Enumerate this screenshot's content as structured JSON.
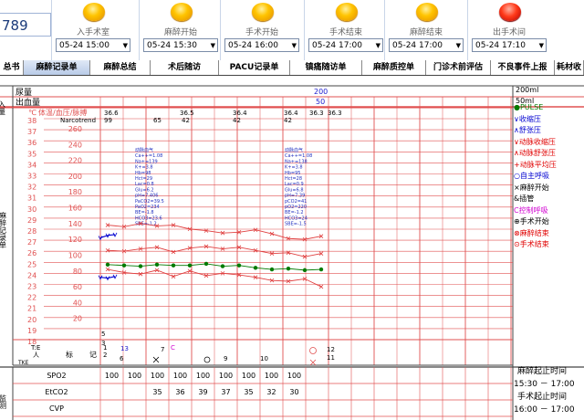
{
  "patient_id": "789",
  "stages": [
    {
      "label": "入手术室",
      "time": "05-24 15:00",
      "color": "yellow"
    },
    {
      "label": "麻醉开始",
      "time": "05-24 15:30",
      "color": "yellow"
    },
    {
      "label": "手术开始",
      "time": "05-24 16:00",
      "color": "yellow"
    },
    {
      "label": "手术结束",
      "time": "05-24 17:00",
      "color": "yellow"
    },
    {
      "label": "麻醉结束",
      "time": "05-24 17:00",
      "color": "yellow"
    },
    {
      "label": "出手术间",
      "time": "05-24 17:10",
      "color": "red"
    }
  ],
  "tabs": [
    {
      "label": "总书",
      "active": false
    },
    {
      "label": "麻醉记录单",
      "active": true
    },
    {
      "label": "麻醉总结",
      "active": false
    },
    {
      "label": "术后随访",
      "active": false
    },
    {
      "label": "PACU记录单",
      "active": false
    },
    {
      "label": "镇痛随访单",
      "active": false
    },
    {
      "label": "麻醉质控单",
      "active": false
    },
    {
      "label": "门诊术前评估",
      "active": false
    },
    {
      "label": "不良事件上报",
      "active": false
    },
    {
      "label": "耗材收",
      "active": false
    }
  ],
  "io_rows": {
    "side_label": "出入量",
    "urine_label": "尿量",
    "output_label": "出血量",
    "urine_value": "200",
    "output_value": "50",
    "urine_total": "200ml",
    "output_total": "50ml"
  },
  "temp_header": {
    "label": "体温/血压/脉搏",
    "temp_unit": "℃",
    "temps": [
      "36.6",
      "36.5",
      "36.4",
      "36.4",
      "36.3",
      "36.3"
    ],
    "narcotrend_label": "Narcotrend",
    "narcotrend_values": [
      "99",
      "65",
      "42",
      "42",
      "42"
    ]
  },
  "axes": {
    "temp_ticks": [
      "38",
      "37",
      "36",
      "35",
      "34",
      "33",
      "32",
      "31",
      "30",
      "29",
      "28",
      "27",
      "26",
      "25",
      "24",
      "23",
      "22",
      "21",
      "20",
      "19",
      "18"
    ],
    "bp_ticks": [
      "260",
      "240",
      "220",
      "200",
      "180",
      "160",
      "140",
      "120",
      "100",
      "80",
      "60",
      "40",
      "20"
    ],
    "side_label": "麻醉记录单"
  },
  "blood_gas": [
    {
      "lines": [
        "动脉血气",
        "Ca++=1.08",
        "Na+=139",
        "K+=3.8",
        "Hb=98",
        "Hct=29",
        "Lac=0.8",
        "Glu=6.2",
        "pH=7.406",
        "PaCO2=39.5",
        "PaO2=234",
        "BE=-1.8",
        "HCO3=23.6",
        "SBE=-1.2"
      ]
    },
    {
      "lines": [
        "动脉血气",
        "Ca++=1.08",
        "Na+=138",
        "K+=3.8",
        "Hb=95",
        "Hct=28",
        "Lac=0.9",
        "Glu=6.8",
        "pH=7.39",
        "pCO2=41",
        "pO2=220",
        "BE=-1.2",
        "HCO3=24",
        "SBE=-1.5"
      ]
    }
  ],
  "legend": [
    {
      "label": "●PULSE",
      "color": "#007a00"
    },
    {
      "label": "∨收缩压",
      "color": "#0000d0"
    },
    {
      "label": "∧舒张压",
      "color": "#0000d0"
    },
    {
      "label": "∨动脉收缩压",
      "color": "#e00000"
    },
    {
      "label": "∧动脉舒张压",
      "color": "#e00000"
    },
    {
      "label": "+动脉平均压",
      "color": "#e00000"
    },
    {
      "label": "○自主呼吸",
      "color": "#0000d0"
    },
    {
      "label": "×麻醉开始",
      "color": "#000000"
    },
    {
      "label": "&插管",
      "color": "#000000"
    },
    {
      "label": "C控制呼吸",
      "color": "#d000d0"
    },
    {
      "label": "⊕手术开始",
      "color": "#000000"
    },
    {
      "label": "⊗麻醉结束",
      "color": "#e00000"
    },
    {
      "label": "⊙手术结束",
      "color": "#e00000"
    }
  ],
  "chart_data": {
    "type": "line",
    "x_columns": 12,
    "series": [
      {
        "name": "动脉收缩压",
        "color": "#e04040",
        "values": [
          138,
          136,
          140,
          137,
          138,
          133,
          131,
          128,
          129,
          132,
          127,
          121,
          120,
          124
        ]
      },
      {
        "name": "动脉平均压",
        "color": "#e04040",
        "values": [
          106,
          105,
          108,
          110,
          104,
          109,
          111,
          108,
          110,
          106,
          102,
          103,
          98,
          102
        ]
      },
      {
        "name": "PULSE",
        "color": "#007a00",
        "values": [
          88,
          87,
          86,
          88,
          87,
          87,
          89,
          86,
          87,
          84,
          82,
          83,
          81,
          82
        ]
      },
      {
        "name": "动脉舒张压",
        "color": "#e04040",
        "values": [
          82,
          78,
          76,
          81,
          73,
          80,
          74,
          77,
          75,
          72,
          68,
          67,
          70,
          60
        ]
      },
      {
        "name": "收缩压",
        "color": "#0000d0",
        "values": [
          122,
          125,
          126
        ]
      },
      {
        "name": "舒张压",
        "color": "#0000d0",
        "values": [
          72,
          71,
          73
        ]
      }
    ],
    "bp_range": [
      0,
      260
    ],
    "temp_range": [
      18,
      38
    ]
  },
  "markers_row": {
    "labels": [
      "标",
      "记"
    ],
    "y_labels": [
      "T:E",
      "人"
    ],
    "items": [
      "1",
      "2",
      "13",
      "7",
      "C",
      "6",
      "9",
      "10",
      "12",
      "11"
    ],
    "bottom_left": "TKE"
  },
  "bottom_table": {
    "rows": [
      {
        "label": "SPO2",
        "values": [
          "100",
          "100",
          "100",
          "100",
          "100",
          "100",
          "100",
          "100",
          "100"
        ]
      },
      {
        "label": "EtCO2",
        "values": [
          "",
          "",
          "35",
          "36",
          "39",
          "37",
          "35",
          "32",
          "30"
        ]
      },
      {
        "label": "CVP",
        "values": [
          "",
          "",
          "",
          "",
          "",
          "",
          "",
          "",
          ""
        ]
      }
    ],
    "side_label": "监测"
  },
  "time_summary": {
    "anes_title": "麻醉起止时间",
    "anes_range": "15:30 － 17:00",
    "op_title": "手术起止时间",
    "op_range": "16:00 － 17:00"
  }
}
